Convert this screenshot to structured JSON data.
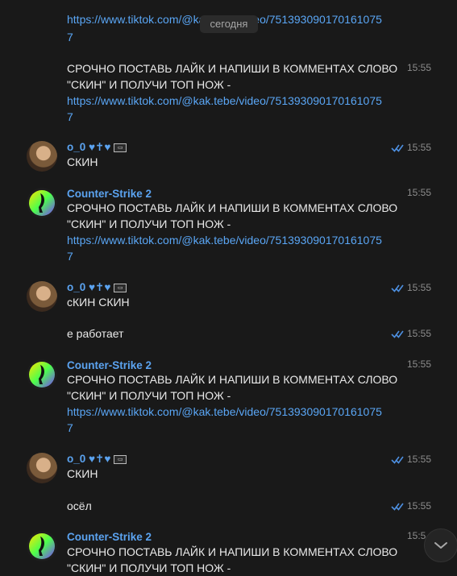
{
  "date_pill": "сегодня",
  "chat": {
    "top_partial": {
      "link_line1": "https://www.tiktok.com/@kak.tebe/video/751393090170161075",
      "link_line2": "7"
    },
    "messages": [
      {
        "text_line1": "СРОЧНО ПОСТАВЬ ЛАЙК И НАПИШИ В КОММЕНТАХ СЛОВО",
        "text_line2": "\"СКИН\" И ПОЛУЧИ ТОП НОЖ -",
        "link_line1": "https://www.tiktok.com/@kak.tebe/video/751393090170161075",
        "link_line2": "7",
        "time": "15:55"
      },
      {
        "author": "o_0 ♥✝♥",
        "text": "СКИН",
        "time": "15:55"
      },
      {
        "author": "Counter-Strike 2",
        "text_line1": "СРОЧНО ПОСТАВЬ ЛАЙК И НАПИШИ В КОММЕНТАХ СЛОВО",
        "text_line2": "\"СКИН\" И ПОЛУЧИ ТОП НОЖ -",
        "link_line1": "https://www.tiktok.com/@kak.tebe/video/751393090170161075",
        "link_line2": "7",
        "time": "15:55"
      },
      {
        "author": "o_0 ♥✝♥",
        "text": "сКИН СКИН",
        "time": "15:55"
      },
      {
        "text": "е работает",
        "time": "15:55"
      },
      {
        "author": "Counter-Strike 2",
        "text_line1": "СРОЧНО ПОСТАВЬ ЛАЙК И НАПИШИ В КОММЕНТАХ СЛОВО",
        "text_line2": "\"СКИН\" И ПОЛУЧИ ТОП НОЖ -",
        "link_line1": "https://www.tiktok.com/@kak.tebe/video/751393090170161075",
        "link_line2": "7",
        "time": "15:55"
      },
      {
        "author": "o_0 ♥✝♥",
        "text": "СКИН",
        "time": "15:55"
      },
      {
        "text": "осёл",
        "time": "15:55"
      },
      {
        "author": "Counter-Strike 2",
        "text_line1": "СРОЧНО ПОСТАВЬ ЛАЙК И НАПИШИ В КОММЕНТАХ СЛОВО",
        "text_line2": "\"СКИН\" И ПОЛУЧИ ТОП НОЖ -",
        "time": "15:5"
      }
    ]
  },
  "icons": {
    "read_receipt": "double-check-icon",
    "scroll_down": "chevron-down-icon",
    "verified_badge": "badge-icon"
  },
  "colors": {
    "background": "#191919",
    "link": "#5aa6f5",
    "author": "#5ba3f0",
    "timestamp": "#8c8c8c",
    "check": "#4d8fe0"
  }
}
